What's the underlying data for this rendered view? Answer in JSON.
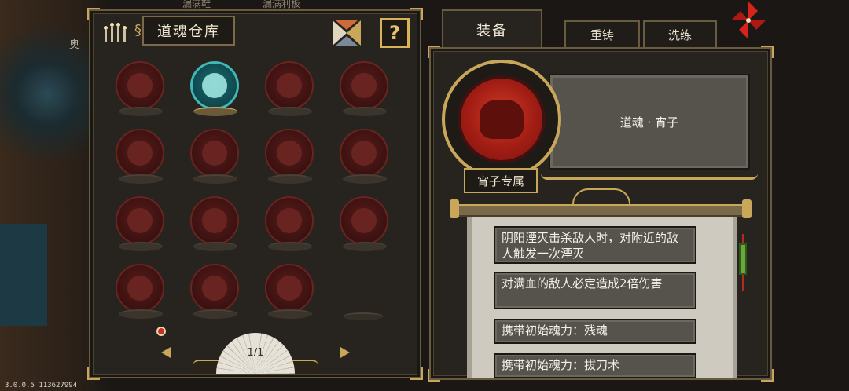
{
  "background": {
    "version": "3.0.0.5 113627994",
    "top_text_left": "漏满鞋",
    "top_text_right": "漏满利板",
    "left_fragment": "奥"
  },
  "left_panel": {
    "title": "道魂仓库",
    "help_icon": "?",
    "pager": {
      "page": "1/1"
    },
    "slots": [
      {
        "state": "owned"
      },
      {
        "state": "equipped"
      },
      {
        "state": "owned"
      },
      {
        "state": "owned"
      },
      {
        "state": "owned"
      },
      {
        "state": "owned"
      },
      {
        "state": "owned"
      },
      {
        "state": "owned"
      },
      {
        "state": "owned"
      },
      {
        "state": "owned"
      },
      {
        "state": "owned"
      },
      {
        "state": "owned"
      },
      {
        "state": "owned",
        "badge": true
      },
      {
        "state": "owned"
      },
      {
        "state": "owned"
      },
      {
        "state": "empty"
      }
    ]
  },
  "tabs": {
    "equip": "装备",
    "recast": "重铸",
    "refine": "洗练"
  },
  "right_panel": {
    "soul_name": "道魂 · 宵子",
    "exclusive_tag": "宵子专属",
    "effects": [
      "阴阳湮灭击杀敌人时，对附近的敌人触发一次湮灭",
      "对满血的敌人必定造成2倍伤害",
      "携带初始魂力：残魂",
      "携带初始魂力：拔刀术"
    ]
  },
  "colors": {
    "accent_gold": "#c9a75a",
    "panel": "#27241f",
    "soul_red": "#a11d14",
    "soul_teal": "#3fb8b8"
  }
}
